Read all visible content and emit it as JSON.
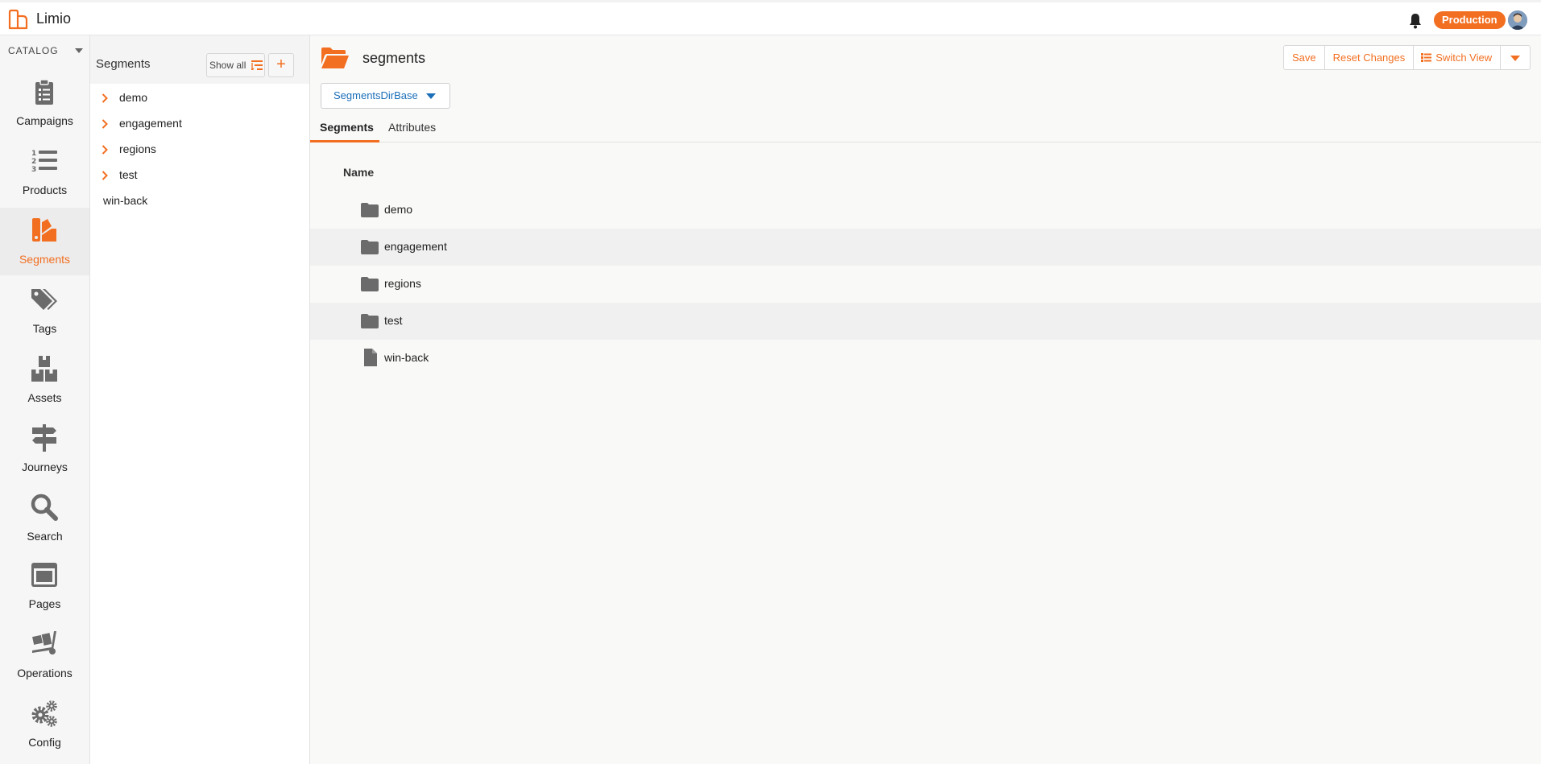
{
  "app": {
    "title": "Limio",
    "environment": "Production",
    "brand_color": "#f26f21"
  },
  "nav": {
    "section_label": "CATALOG",
    "items": [
      {
        "label": "Campaigns",
        "icon": "clipboard-icon",
        "active": false
      },
      {
        "label": "Products",
        "icon": "numbered-list-icon",
        "active": false
      },
      {
        "label": "Segments",
        "icon": "swatches-icon",
        "active": true
      },
      {
        "label": "Tags",
        "icon": "tags-icon",
        "active": false
      },
      {
        "label": "Assets",
        "icon": "boxes-icon",
        "active": false
      },
      {
        "label": "Journeys",
        "icon": "signpost-icon",
        "active": false
      },
      {
        "label": "Search",
        "icon": "search-icon",
        "active": false
      },
      {
        "label": "Pages",
        "icon": "page-icon",
        "active": false
      },
      {
        "label": "Operations",
        "icon": "dolly-icon",
        "active": false
      },
      {
        "label": "Config",
        "icon": "gears-icon",
        "active": false
      }
    ]
  },
  "tree": {
    "title": "Segments",
    "show_all_label": "Show all",
    "add_label": "+",
    "items": [
      {
        "label": "demo",
        "expandable": true
      },
      {
        "label": "engagement",
        "expandable": true
      },
      {
        "label": "regions",
        "expandable": true
      },
      {
        "label": "test",
        "expandable": true
      },
      {
        "label": "win-back",
        "expandable": false
      }
    ]
  },
  "main": {
    "title": "segments",
    "buttons": {
      "save": "Save",
      "reset": "Reset Changes",
      "switch_view": "Switch View"
    },
    "dir_select": "SegmentsDirBase",
    "tabs": [
      {
        "label": "Segments",
        "active": true
      },
      {
        "label": "Attributes",
        "active": false
      }
    ],
    "column_header": "Name",
    "rows": [
      {
        "name": "demo",
        "type": "folder"
      },
      {
        "name": "engagement",
        "type": "folder"
      },
      {
        "name": "regions",
        "type": "folder"
      },
      {
        "name": "test",
        "type": "folder"
      },
      {
        "name": "win-back",
        "type": "file"
      }
    ]
  }
}
